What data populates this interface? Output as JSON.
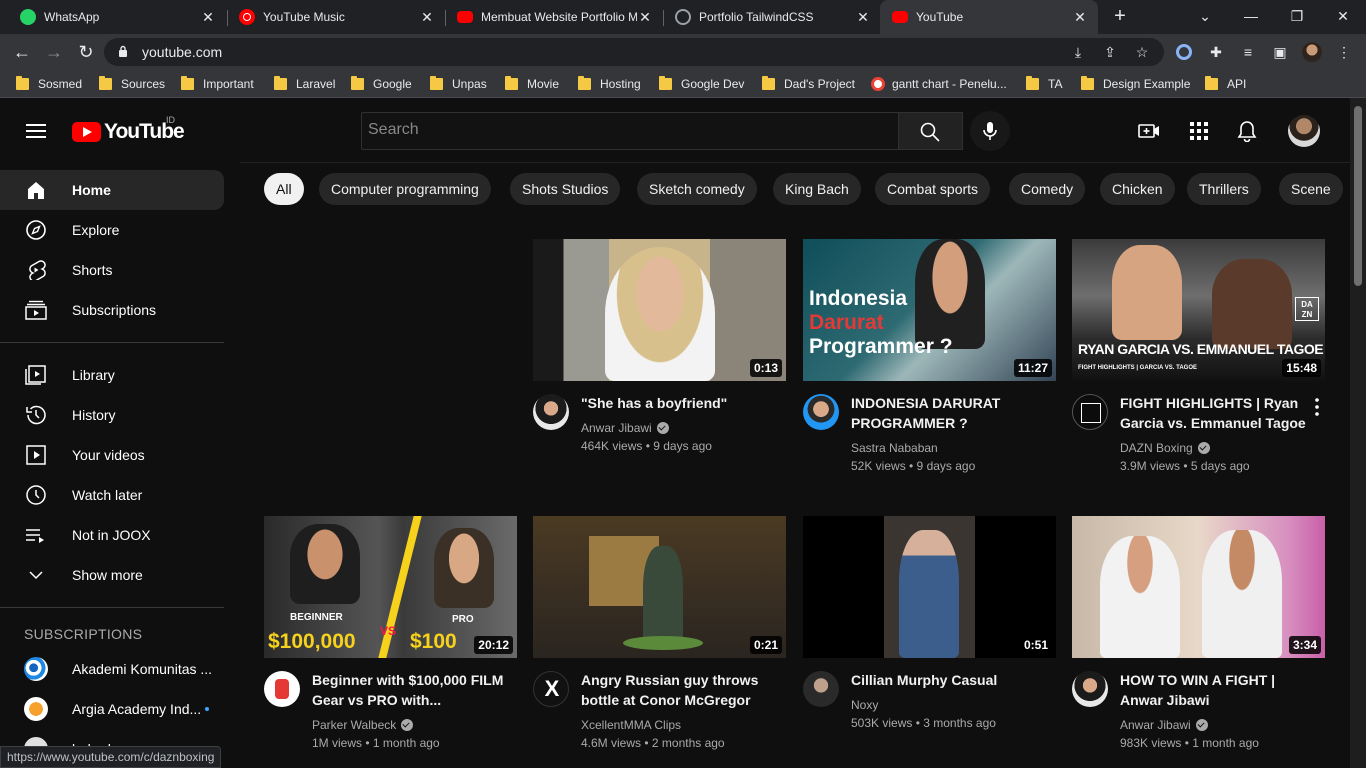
{
  "browser": {
    "tabs": [
      {
        "title": "WhatsApp",
        "favicon": "whatsapp-icon"
      },
      {
        "title": "YouTube Music",
        "favicon": "youtube-music-icon"
      },
      {
        "title": "Membuat Website Portfolio M",
        "favicon": "youtube-icon"
      },
      {
        "title": "Portfolio TailwindCSS",
        "favicon": "globe-icon"
      },
      {
        "title": "YouTube",
        "favicon": "youtube-icon"
      }
    ],
    "url": "youtube.com",
    "bookmarks": [
      "Sosmed",
      "Sources",
      "Important",
      "Laravel",
      "Google",
      "Unpas",
      "Movie",
      "Hosting",
      "Google Dev",
      "Dad's Project",
      "gantt chart - Penelu...",
      "TA",
      "Design Example",
      "API"
    ],
    "status_url": "https://www.youtube.com/c/daznboxing"
  },
  "youtube": {
    "logo_text": "YouTube",
    "country_code": "ID",
    "search_placeholder": "Search",
    "sidebar": {
      "primary": [
        "Home",
        "Explore",
        "Shorts",
        "Subscriptions"
      ],
      "secondary": [
        "Library",
        "History",
        "Your videos",
        "Watch later",
        "Not in JOOX",
        "Show more"
      ],
      "subscriptions_header": "SUBSCRIPTIONS",
      "subscriptions": [
        "Akademi Komunitas ...",
        "Argia Academy Ind...",
        "balerdemy"
      ]
    },
    "chips": [
      "All",
      "Computer programming",
      "Shots Studios",
      "Sketch comedy",
      "King Bach",
      "Combat sports",
      "Comedy",
      "Chicken",
      "Thrillers",
      "Scene"
    ],
    "videos": [
      {
        "title": "\"She has a boyfriend\"",
        "channel": "Anwar Jibawi",
        "verified": true,
        "stats": "464K views • 9 days ago",
        "duration": "0:13"
      },
      {
        "title": "INDONESIA DARURAT PROGRAMMER ?",
        "channel": "Sastra Nababan",
        "verified": false,
        "stats": "52K views • 9 days ago",
        "duration": "11:27",
        "thumb_text_1": "Indonesia",
        "thumb_text_2": "Darurat",
        "thumb_text_3": "Programmer ?"
      },
      {
        "title": "FIGHT HIGHLIGHTS | Ryan Garcia vs. Emmanuel Tagoe",
        "channel": "DAZN Boxing",
        "verified": true,
        "stats": "3.9M views • 5 days ago",
        "duration": "15:48",
        "thumb_text_1": "RYAN GARCIA VS. EMMANUEL TAGOE",
        "thumb_text_2": "FIGHT HIGHLIGHTS | GARCIA VS. TAGOE",
        "thumb_logo": "DA ZN"
      },
      {
        "title": "Beginner with $100,000 FILM Gear vs PRO with...",
        "channel": "Parker Walbeck",
        "verified": true,
        "stats": "1M views • 1 month ago",
        "duration": "20:12",
        "thumb_text_1": "BEGINNER",
        "thumb_text_2": "$100,000",
        "thumb_text_3": "VS",
        "thumb_text_4": "PRO",
        "thumb_text_5": "$100"
      },
      {
        "title": "Angry Russian guy throws bottle at Conor McGregor",
        "channel": "XcellentMMA Clips",
        "verified": false,
        "stats": "4.6M views • 2 months ago",
        "duration": "0:21"
      },
      {
        "title": "Cillian Murphy Casual",
        "channel": "Noxy",
        "verified": false,
        "stats": "503K views • 3 months ago",
        "duration": "0:51"
      },
      {
        "title": "HOW TO WIN A FIGHT | Anwar Jibawi",
        "channel": "Anwar Jibawi",
        "verified": true,
        "stats": "983K views • 1 month ago",
        "duration": "3:34"
      }
    ]
  }
}
